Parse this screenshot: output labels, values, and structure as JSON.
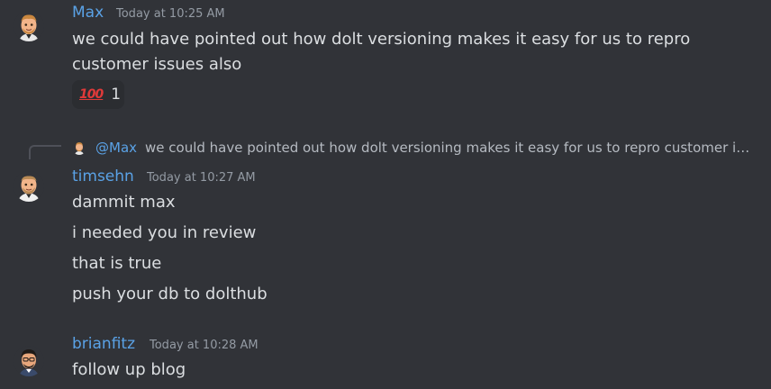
{
  "colors": {
    "background": "#313338",
    "username": "#5aa2e6",
    "message_text": "#dbdee1",
    "timestamp": "#949ba4",
    "reaction_bg": "#2b2d31"
  },
  "messages": [
    {
      "author": "Max",
      "timestamp": "Today at 10:25 AM",
      "avatar_icon": "bitmoji-avatar-icon",
      "lines": [
        "we could have pointed out how dolt versioning makes it easy for us to repro",
        "customer issues also"
      ],
      "reactions": [
        {
          "emoji": "100-icon",
          "glyph": "💯",
          "label": "100",
          "count": "1"
        }
      ]
    },
    {
      "author": "timsehn",
      "timestamp": "Today at 10:27 AM",
      "avatar_icon": "bitmoji-avatar-icon",
      "reply_to": {
        "mention": "@Max",
        "text": "we could have pointed out how dolt versioning makes it easy for us to repro customer issues also"
      },
      "lines": [
        "dammit max",
        "i needed you in review",
        "that is true",
        "push your db to dolthub"
      ]
    },
    {
      "author": "brianfitz",
      "timestamp": "Today at 10:28 AM",
      "avatar_icon": "bitmoji-avatar-icon",
      "lines": [
        "follow up blog"
      ]
    }
  ]
}
